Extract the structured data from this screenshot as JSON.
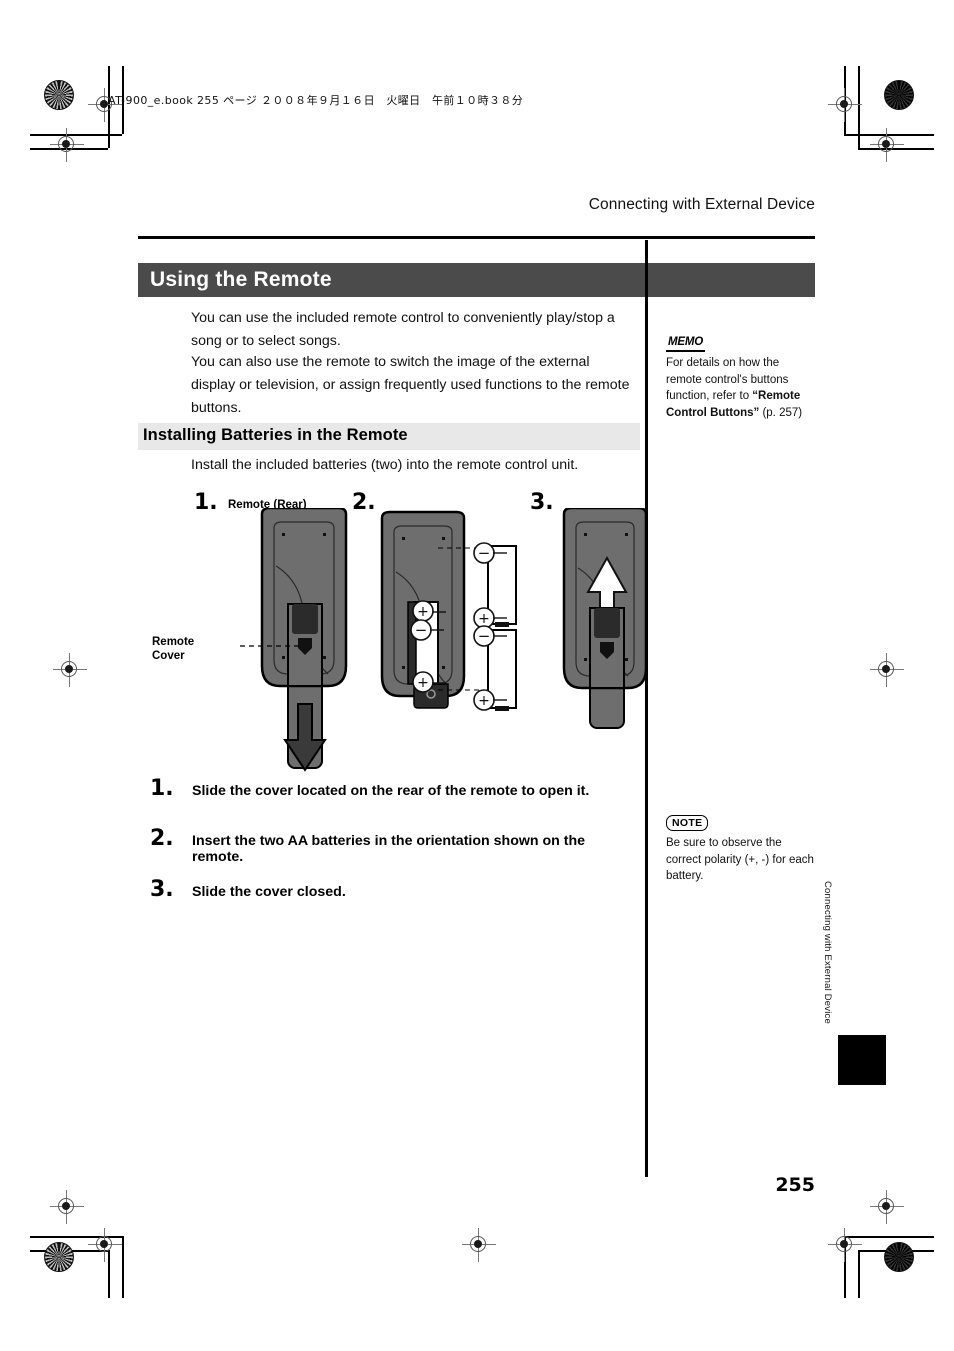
{
  "print_marks": {
    "book_info": "AT-900_e.book  255 ページ  ２００８年９月１６日　火曜日　午前１０時３８分"
  },
  "page": {
    "running_head": "Connecting with External Device",
    "page_number": "255",
    "side_tab_text": "Connecting with External Device"
  },
  "section": {
    "title": "Using the Remote",
    "intro_paragraphs": [
      "You can use the included remote control to conveniently play/stop a song or to select songs.",
      "You can also use the remote to switch the image of the external display or television, or assign frequently used functions to the remote buttons."
    ]
  },
  "subsection": {
    "title": "Installing Batteries in the Remote",
    "intro": "Install the included batteries (two) into the remote control unit."
  },
  "figure": {
    "step_numbers": [
      "1.",
      "2.",
      "3."
    ],
    "labels": {
      "remote_rear": "Remote (Rear)",
      "remote_cover_line1": "Remote",
      "remote_cover_line2": "Cover",
      "plus": "+",
      "minus": "–"
    }
  },
  "procedure": [
    {
      "num": "1.",
      "text": "Slide the cover located on the rear of the remote to open it."
    },
    {
      "num": "2.",
      "text": "Insert the two AA batteries in the orientation shown on the remote."
    },
    {
      "num": "3.",
      "text": "Slide the cover closed."
    }
  ],
  "side_notes": {
    "memo": {
      "badge": "MEMO",
      "text_part1": "For details on how the remote control's buttons function, refer to ",
      "text_bold": "“Remote Control Buttons”",
      "text_part2": " (p. 257)"
    },
    "note": {
      "badge": "NOTE",
      "text": "Be sure to observe the correct polarity (+, -) for each battery."
    }
  },
  "colors": {
    "section_bar": "#4b4b4b",
    "subhead_bar": "#e8e8e8",
    "remote_body": "#6e6e6e",
    "remote_dark": "#3b3b3b",
    "rule": "#000000"
  }
}
